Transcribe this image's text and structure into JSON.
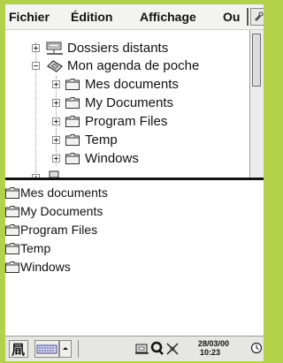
{
  "menubar": {
    "items": [
      {
        "label": "Fichier"
      },
      {
        "label": "Édition"
      },
      {
        "label": "Affichage"
      },
      {
        "label": "Ou"
      }
    ]
  },
  "tree": {
    "items": [
      {
        "label": "Dossiers distants",
        "icon": "network-drive-icon",
        "state": "collapsed"
      },
      {
        "label": "Mon agenda de poche",
        "icon": "handheld-device-icon",
        "state": "expanded"
      },
      {
        "label": "Mes documents",
        "icon": "folder-icon",
        "state": "collapsed"
      },
      {
        "label": "My Documents",
        "icon": "folder-icon",
        "state": "collapsed"
      },
      {
        "label": "Program Files",
        "icon": "folder-icon",
        "state": "collapsed"
      },
      {
        "label": "Temp",
        "icon": "folder-icon",
        "state": "collapsed"
      },
      {
        "label": "Windows",
        "icon": "folder-icon",
        "state": "collapsed"
      }
    ]
  },
  "list": {
    "items": [
      {
        "label": "Mes documents"
      },
      {
        "label": "My Documents"
      },
      {
        "label": "Program Files"
      },
      {
        "label": "Temp"
      },
      {
        "label": "Windows"
      }
    ]
  },
  "taskbar": {
    "date": "28/03/00",
    "time": "10:23",
    "icons": [
      "start-icon",
      "keyboard-icon",
      "input-arrow-icon",
      "pc-connection-icon",
      "search-icon",
      "satellite-icon",
      "clock-icon"
    ]
  },
  "colors": {
    "background": "#b2d24a",
    "window": "#ffffff",
    "splitter": "#111111"
  }
}
